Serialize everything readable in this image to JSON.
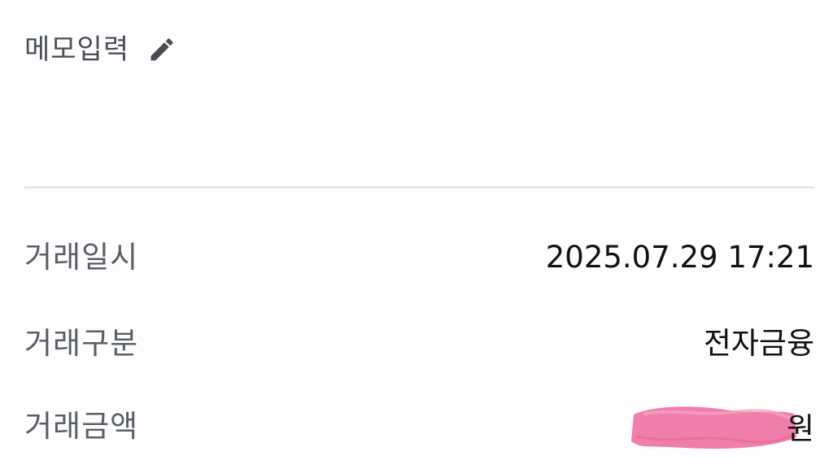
{
  "memo": {
    "label": "메모입력",
    "icon": "pencil-icon"
  },
  "transaction": {
    "rows": [
      {
        "label": "거래일시",
        "value": "2025.07.29 17:21"
      },
      {
        "label": "거래구분",
        "value": "전자금융"
      },
      {
        "label": "거래금액",
        "value_suffix": "원"
      }
    ]
  },
  "colors": {
    "background": "#fdfdfe",
    "label": "#5a5e66",
    "value": "#111111",
    "divider": "#e6e7ee",
    "redaction": "#ef77a5"
  }
}
